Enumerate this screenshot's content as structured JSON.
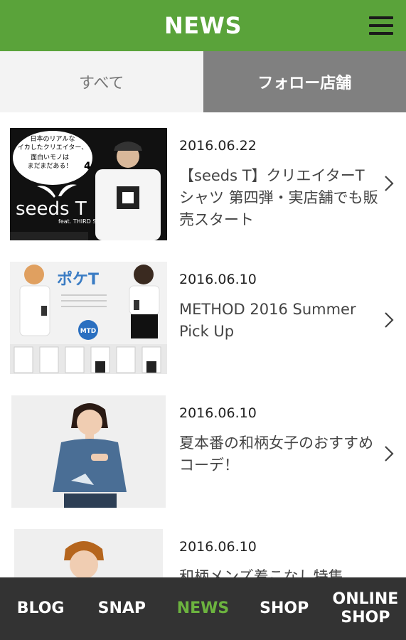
{
  "header": {
    "title": "NEWS",
    "menu_icon": "hamburger-menu-icon"
  },
  "tabs": [
    {
      "label": "すべて",
      "active": false
    },
    {
      "label": "フォロー店舗",
      "active": true
    }
  ],
  "news": [
    {
      "date": "2016.06.22",
      "title": "【seeds T】クリエイターTシャツ 第四弾・実店舗でも販売スタート",
      "thumb": {
        "text1": "日本のリアルな",
        "text2": "イカしたクリエイター、",
        "text3": "面白いモノは",
        "text4": "まだまだある！",
        "number": "4",
        "logo": "seeds T",
        "sub": "feat. THIRD SOUL"
      }
    },
    {
      "date": "2016.06.10",
      "title": "METHOD 2016 Summer Pick Up",
      "thumb": {
        "logo": "ポケT",
        "badge": "MTD"
      }
    },
    {
      "date": "2016.06.10",
      "title": "夏本番の和柄女子のおすすめコーデ！",
      "thumb": {}
    },
    {
      "date": "2016.06.10",
      "title": "和柄メンズ着こなし特集",
      "thumb": {}
    }
  ],
  "bottom_nav": [
    {
      "label": "BLOG"
    },
    {
      "label": "SNAP"
    },
    {
      "label": "NEWS"
    },
    {
      "label": "SHOP"
    },
    {
      "label_line1": "ONLINE",
      "label_line2": "SHOP"
    }
  ],
  "colors": {
    "brand_green": "#5aa33a",
    "active_nav": "#6cb33f",
    "tab_active_bg": "#808080",
    "nav_bg": "#333333"
  }
}
